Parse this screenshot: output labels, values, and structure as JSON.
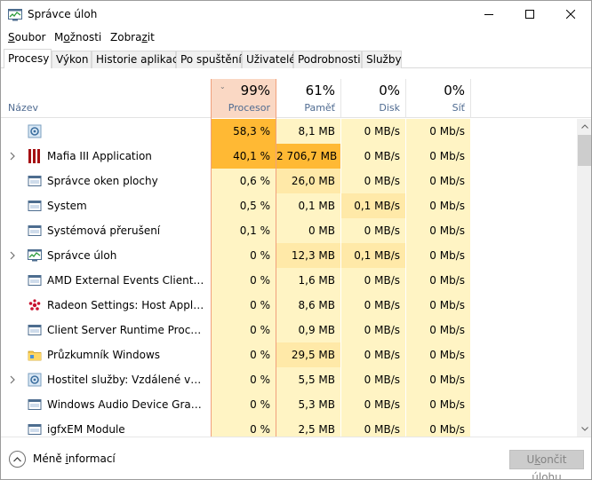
{
  "window": {
    "title": "Správce úloh"
  },
  "menu": [
    {
      "pre": "",
      "key": "S",
      "post": "oubor"
    },
    {
      "pre": "M",
      "key": "o",
      "post": "žnosti"
    },
    {
      "pre": "Zobra",
      "key": "z",
      "post": "it"
    }
  ],
  "tabs": [
    "Procesy",
    "Výkon",
    "Historie aplikací",
    "Po spuštění",
    "Uživatelé",
    "Podrobnosti",
    "Služby"
  ],
  "columns": {
    "name": "Název",
    "cpu": {
      "pct": "99%",
      "label": "Procesor"
    },
    "memory": {
      "pct": "61%",
      "label": "Paměť"
    },
    "disk": {
      "pct": "0%",
      "label": "Disk"
    },
    "network": {
      "pct": "0%",
      "label": "Síť"
    }
  },
  "colors": {
    "cpu_high": "#ffb934",
    "heat_1": "#fff4c4",
    "heat_2": "#ffe9a8",
    "heat_3": "#ffd567",
    "sorted_header": "#fad8c4"
  },
  "processes": [
    {
      "name": "",
      "icon": "gear-icon",
      "expandable": false,
      "cpu": "58,3 %",
      "memory": "8,1 MB",
      "disk": "0 MB/s",
      "network": "0 Mb/s",
      "cpu_heat": 4,
      "mem_heat": 1,
      "disk_heat": 1,
      "net_heat": 1
    },
    {
      "name": "Mafia III Application",
      "icon": "mafia-icon",
      "expandable": true,
      "cpu": "40,1 %",
      "memory": "2 706,7 MB",
      "disk": "0 MB/s",
      "network": "0 Mb/s",
      "cpu_heat": 4,
      "mem_heat": 4,
      "disk_heat": 1,
      "net_heat": 1
    },
    {
      "name": "Správce oken plochy",
      "icon": "window-icon",
      "expandable": false,
      "cpu": "0,6 %",
      "memory": "26,0 MB",
      "disk": "0 MB/s",
      "network": "0 Mb/s",
      "cpu_heat": 1,
      "mem_heat": 2,
      "disk_heat": 1,
      "net_heat": 1
    },
    {
      "name": "System",
      "icon": "window-icon",
      "expandable": false,
      "cpu": "0,5 %",
      "memory": "0,1 MB",
      "disk": "0,1 MB/s",
      "network": "0 Mb/s",
      "cpu_heat": 1,
      "mem_heat": 1,
      "disk_heat": 2,
      "net_heat": 1
    },
    {
      "name": "Systémová přerušení",
      "icon": "window-icon",
      "expandable": false,
      "cpu": "0,1 %",
      "memory": "0 MB",
      "disk": "0 MB/s",
      "network": "0 Mb/s",
      "cpu_heat": 1,
      "mem_heat": 1,
      "disk_heat": 1,
      "net_heat": 1
    },
    {
      "name": "Správce úloh",
      "icon": "task-manager-icon",
      "expandable": true,
      "cpu": "0 %",
      "memory": "12,3 MB",
      "disk": "0,1 MB/s",
      "network": "0 Mb/s",
      "cpu_heat": 1,
      "mem_heat": 2,
      "disk_heat": 2,
      "net_heat": 1
    },
    {
      "name": "AMD External Events Client Mo...",
      "icon": "window-icon",
      "expandable": false,
      "cpu": "0 %",
      "memory": "1,6 MB",
      "disk": "0 MB/s",
      "network": "0 Mb/s",
      "cpu_heat": 1,
      "mem_heat": 1,
      "disk_heat": 1,
      "net_heat": 1
    },
    {
      "name": "Radeon Settings: Host Applicati...",
      "icon": "radeon-icon",
      "expandable": false,
      "cpu": "0 %",
      "memory": "8,6 MB",
      "disk": "0 MB/s",
      "network": "0 Mb/s",
      "cpu_heat": 1,
      "mem_heat": 1,
      "disk_heat": 1,
      "net_heat": 1
    },
    {
      "name": "Client Server Runtime Process",
      "icon": "window-icon",
      "expandable": false,
      "cpu": "0 %",
      "memory": "0,9 MB",
      "disk": "0 MB/s",
      "network": "0 Mb/s",
      "cpu_heat": 1,
      "mem_heat": 1,
      "disk_heat": 1,
      "net_heat": 1
    },
    {
      "name": "Průzkumník Windows",
      "icon": "folder-icon",
      "expandable": false,
      "cpu": "0 %",
      "memory": "29,5 MB",
      "disk": "0 MB/s",
      "network": "0 Mb/s",
      "cpu_heat": 1,
      "mem_heat": 2,
      "disk_heat": 1,
      "net_heat": 1
    },
    {
      "name": "Hostitel služby: Vzdálené volání ...",
      "icon": "gear-icon",
      "expandable": true,
      "cpu": "0 %",
      "memory": "5,5 MB",
      "disk": "0 MB/s",
      "network": "0 Mb/s",
      "cpu_heat": 1,
      "mem_heat": 1,
      "disk_heat": 1,
      "net_heat": 1
    },
    {
      "name": "Windows Audio Device Graph Is...",
      "icon": "window-icon",
      "expandable": false,
      "cpu": "0 %",
      "memory": "5,3 MB",
      "disk": "0 MB/s",
      "network": "0 Mb/s",
      "cpu_heat": 1,
      "mem_heat": 1,
      "disk_heat": 1,
      "net_heat": 1
    },
    {
      "name": "igfxEM Module",
      "icon": "window-icon",
      "expandable": false,
      "cpu": "0 %",
      "memory": "2,5 MB",
      "disk": "0 MB/s",
      "network": "0 Mb/s",
      "cpu_heat": 1,
      "mem_heat": 1,
      "disk_heat": 1,
      "net_heat": 1
    }
  ],
  "footer": {
    "less_info_pre": "Méně ",
    "less_info_key": "i",
    "less_info_post": "nformací",
    "end_task_pre": "U",
    "end_task_key": "k",
    "end_task_post": "ončit úlohu"
  }
}
